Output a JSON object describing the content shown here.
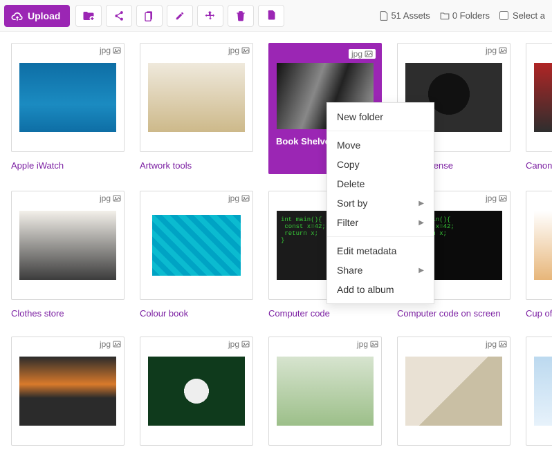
{
  "toolbar": {
    "upload_label": "Upload"
  },
  "status": {
    "asset_count": "51 Assets",
    "folder_count": "0 Folders",
    "select_all_label": "Select a"
  },
  "ext": "jpg",
  "assets": [
    {
      "name": "Apple iWatch",
      "img": "img-watch",
      "selected": false
    },
    {
      "name": "Artwork tools",
      "img": "img-tools",
      "selected": false
    },
    {
      "name": "Book Shelves",
      "img": "img-books",
      "selected": true
    },
    {
      "name": "Camera lense",
      "img": "img-camera",
      "selected": false
    },
    {
      "name": "Canon c",
      "img": "img-canon",
      "selected": false
    },
    {
      "name": "Clothes store",
      "img": "img-clothes",
      "selected": false
    },
    {
      "name": "Colour book",
      "img": "img-colour",
      "selected": false
    },
    {
      "name": "Computer code",
      "img": "img-code1",
      "selected": false
    },
    {
      "name": "Computer code on screen",
      "img": "img-code2",
      "selected": false
    },
    {
      "name": "Cup of t",
      "img": "img-cup",
      "selected": false
    },
    {
      "name": "",
      "img": "img-pencils",
      "selected": false
    },
    {
      "name": "",
      "img": "img-drone",
      "selected": false
    },
    {
      "name": "",
      "img": "img-money",
      "selected": false
    },
    {
      "name": "",
      "img": "img-env",
      "selected": false
    },
    {
      "name": "",
      "img": "img-blue",
      "selected": false
    }
  ],
  "context_menu": {
    "new_folder": "New folder",
    "move": "Move",
    "copy": "Copy",
    "delete": "Delete",
    "sort_by": "Sort by",
    "filter": "Filter",
    "edit_metadata": "Edit metadata",
    "share": "Share",
    "add_to_album": "Add to album"
  }
}
